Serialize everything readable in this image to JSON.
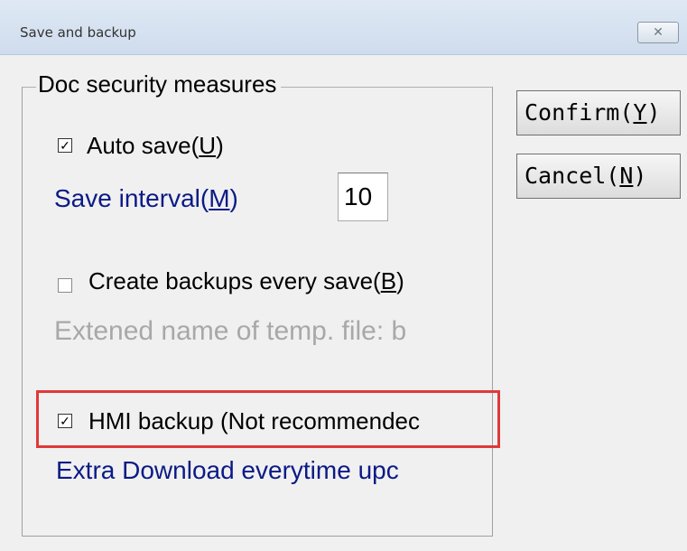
{
  "window": {
    "title": "Save and backup",
    "close_glyph": "✕"
  },
  "group": {
    "title": "Doc security measures"
  },
  "buttons": {
    "confirm": {
      "text": "Confirm(",
      "mnemonic": "Y",
      "end": ")"
    },
    "cancel": {
      "text": "Cancel(",
      "mnemonic": "N",
      "end": ")"
    }
  },
  "auto_save": {
    "checked": true,
    "check_glyph": "✓",
    "text": "Auto save(",
    "mnemonic": "U",
    "end": ")"
  },
  "save_interval": {
    "text": "Save interval(",
    "mnemonic": "M",
    "end": ")",
    "value": "10"
  },
  "create_backups": {
    "checked": false,
    "check_glyph": "",
    "text": "Create backups every save(",
    "mnemonic": "B",
    "end": ")"
  },
  "temp_file": {
    "text": "Extened name of temp. file: b"
  },
  "hmi_backup": {
    "checked": true,
    "check_glyph": "✓",
    "text": "HMI backup (Not recommendec"
  },
  "extra_download": {
    "text": "Extra Download everytime upc"
  },
  "colors": {
    "highlight": "#e0383a",
    "blue_text": "#0b1a86",
    "disabled_text": "#a8a8a8"
  },
  "icons": {
    "close": "close-icon",
    "checkbox": "checkmark-icon"
  }
}
